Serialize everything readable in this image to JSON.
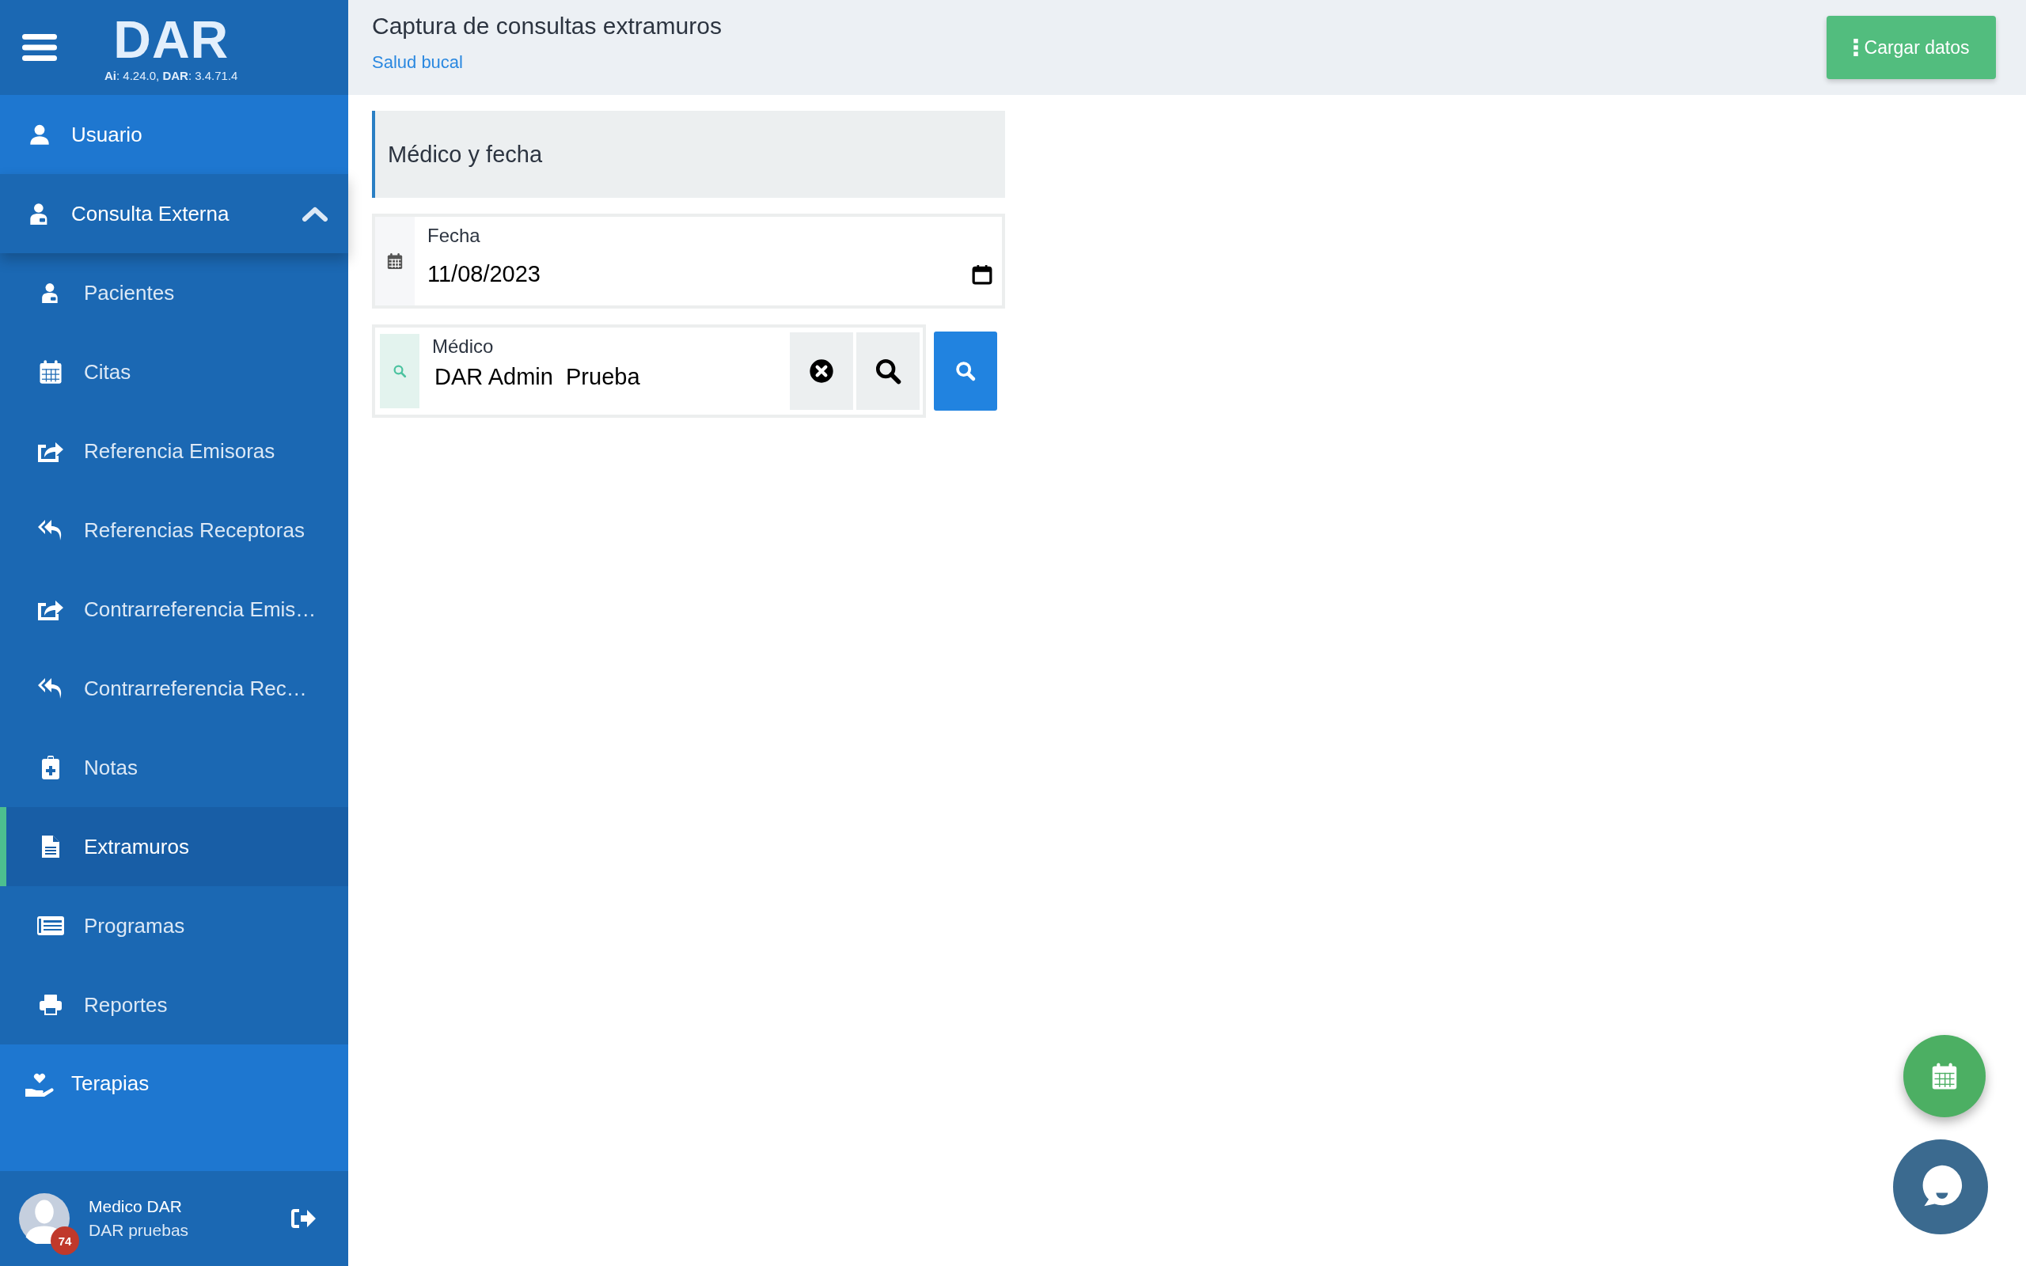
{
  "brand": {
    "logo": "DAR",
    "version": "**Ai**: 4.24.0, **DAR**: 3.4.71.4"
  },
  "sidebar": {
    "items": [
      {
        "label": "Usuario",
        "selected": false
      },
      {
        "label": "Consulta Externa",
        "selected": false,
        "expanded": true,
        "children": [
          {
            "label": "Pacientes",
            "selected": false
          },
          {
            "label": "Citas",
            "selected": false
          },
          {
            "label": "Referencia Emisoras",
            "selected": false
          },
          {
            "label": "Referencias Receptoras",
            "selected": false
          },
          {
            "label": "Contrarreferencia Emis…",
            "selected": false
          },
          {
            "label": "Contrarreferencia Rec…",
            "selected": false
          },
          {
            "label": "Notas",
            "selected": false
          },
          {
            "label": "Extramuros",
            "selected": true
          },
          {
            "label": "Programas",
            "selected": false
          },
          {
            "label": "Reportes",
            "selected": false
          }
        ]
      },
      {
        "label": "Terapias",
        "selected": false
      }
    ]
  },
  "user": {
    "name": "Medico DAR",
    "organization": "DAR pruebas",
    "badge": "74"
  },
  "page": {
    "title": "Captura de consultas extramuros",
    "subtitle": "Salud bucal",
    "action": "Cargar datos"
  },
  "section": {
    "title": "Médico y fecha"
  },
  "fields": {
    "fecha": {
      "label": "Fecha",
      "value": "11/08/2023"
    },
    "medico": {
      "label": "Médico",
      "value": "DAR Admin  Prueba"
    }
  }
}
